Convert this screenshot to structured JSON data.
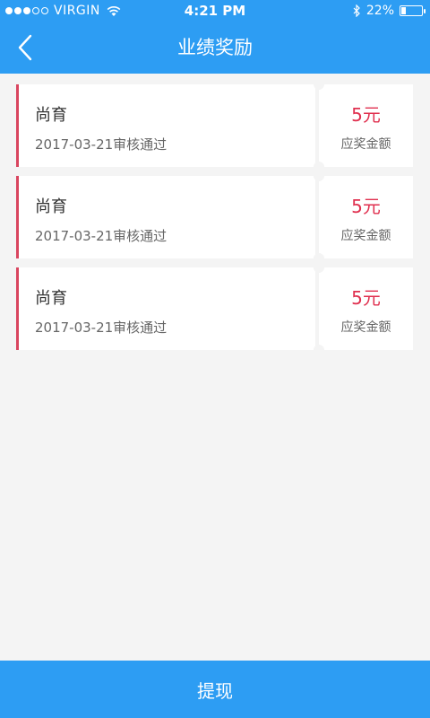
{
  "status_bar": {
    "carrier": "VIRGIN",
    "time": "4:21 PM",
    "battery": "22%",
    "battery_level": 0.22
  },
  "nav": {
    "title": "业绩奖励",
    "back_icon": "chevron-left-icon"
  },
  "rewards": [
    {
      "name": "尚育",
      "date_status": "2017-03-21审核通过",
      "amount": "5元",
      "amount_label": "应奖金额"
    },
    {
      "name": "尚育",
      "date_status": "2017-03-21审核通过",
      "amount": "5元",
      "amount_label": "应奖金额"
    },
    {
      "name": "尚育",
      "date_status": "2017-03-21审核通过",
      "amount": "5元",
      "amount_label": "应奖金额"
    }
  ],
  "footer": {
    "withdraw_label": "提现"
  },
  "colors": {
    "primary": "#2d9df3",
    "accent": "#e0304f",
    "background": "#f4f4f4"
  }
}
